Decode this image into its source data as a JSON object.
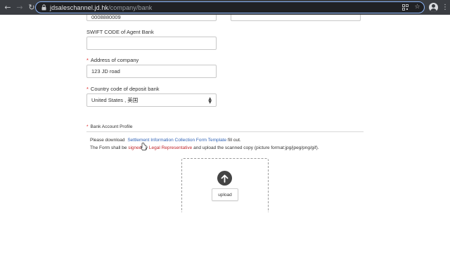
{
  "browser": {
    "url_domain": "jdsaleschannel.jd.hk",
    "url_path": "/company/bank"
  },
  "form": {
    "top_left_value": "0008880009",
    "top_right_value": "",
    "swift_label": "SWIFT CODE of Agent Bank",
    "swift_value": "",
    "address_label": "Address of company",
    "address_value": "123 JD road",
    "country_label": "Country code of deposit bank",
    "country_value": "United States , 美国",
    "required_mark": "*"
  },
  "bank_profile": {
    "label": "Bank Account Profile",
    "line1_prefix": "Please download",
    "line1_link": "Settlement Information Collection Form Template",
    "line1_suffix": "fill out.",
    "line2_prefix": "The Form shall be",
    "line2_signed": "signed",
    "line2_by": "by",
    "line2_rep": "Legal Representative",
    "line2_suffix": "and upload the scanned copy (picture format:jpg/jpeg/png/gif).",
    "upload_label": "upload"
  },
  "colors": {
    "required": "#e02020",
    "link": "#2f62b5",
    "link_red": "#c0272d",
    "omnibox_focus": "#8ab4f8"
  }
}
